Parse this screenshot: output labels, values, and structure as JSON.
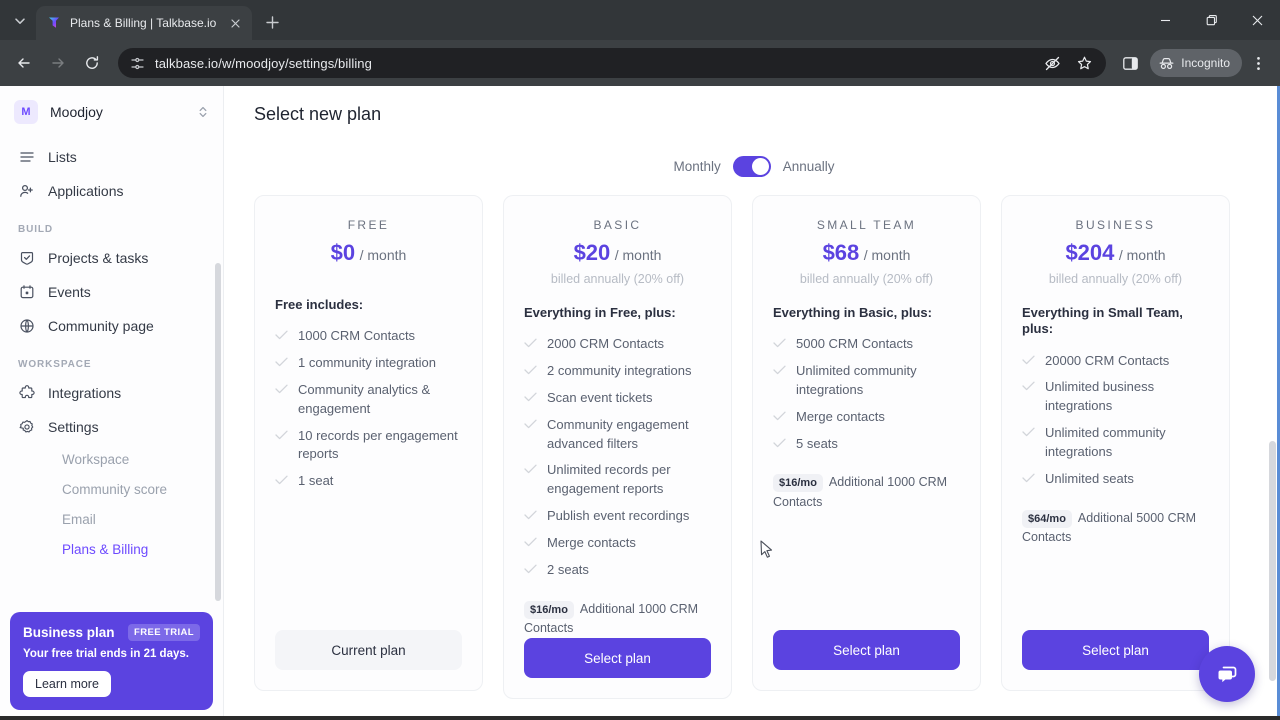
{
  "browser": {
    "tab": {
      "title": "Plans & Billing | Talkbase.io",
      "favicon_icon": "talkbase-logo-icon",
      "close_icon": "close-icon"
    },
    "tab_list_icon": "chevron-down-icon",
    "new_tab_label": "+",
    "window": {
      "minimize_icon": "minimize-icon",
      "maximize_icon": "maximize-icon",
      "close_icon": "close-icon"
    },
    "nav": {
      "back_icon": "back-arrow-icon",
      "forward_icon": "forward-arrow-icon",
      "reload_icon": "reload-icon"
    },
    "omnibox": {
      "url": "talkbase.io/w/moodjoy/settings/billing",
      "site_settings_icon": "tune-icon",
      "tracking_icon": "eye-slash-icon",
      "bookmark_icon": "star-icon"
    },
    "side_panel_icon": "side-panel-icon",
    "incognito": {
      "label": "Incognito",
      "icon": "incognito-hat-icon"
    },
    "menu_icon": "three-dot-menu-icon"
  },
  "sidebar": {
    "workspace": {
      "initial": "M",
      "name": "Moodjoy",
      "switcher_icon": "chevron-updown-icon"
    },
    "items": [
      {
        "label": "Lists",
        "icon": "list-icon"
      },
      {
        "label": "Applications",
        "icon": "user-plus-icon"
      }
    ],
    "sections": [
      {
        "label": "BUILD",
        "items": [
          {
            "label": "Projects & tasks",
            "icon": "checkbox-shield-icon"
          },
          {
            "label": "Events",
            "icon": "calendar-icon"
          },
          {
            "label": "Community page",
            "icon": "globe-icon"
          }
        ]
      },
      {
        "label": "WORKSPACE",
        "items": [
          {
            "label": "Integrations",
            "icon": "puzzle-icon"
          },
          {
            "label": "Settings",
            "icon": "gear-icon"
          }
        ]
      }
    ],
    "settings_subitems": [
      {
        "label": "Workspace",
        "active": false
      },
      {
        "label": "Community score",
        "active": false
      },
      {
        "label": "Email",
        "active": false
      },
      {
        "label": "Plans & Billing",
        "active": true
      }
    ],
    "trial_card": {
      "title": "Business plan",
      "badge": "FREE TRIAL",
      "subtitle": "Your free trial ends in 21 days.",
      "button": "Learn more"
    }
  },
  "main": {
    "title": "Select new plan",
    "billing_toggle": {
      "left_label": "Monthly",
      "right_label": "Annually",
      "selected": "Annually"
    },
    "plans": [
      {
        "name": "FREE",
        "price": "$0",
        "period": "/ month",
        "billed_note": "",
        "includes_heading": "Free includes:",
        "features": [
          "1000 CRM Contacts",
          "1 community integration",
          "Community analytics & engagement",
          "10 records per engagement reports",
          "1 seat"
        ],
        "addon_price": "",
        "addon_text": "",
        "cta": "Current plan",
        "cta_style": "ghost"
      },
      {
        "name": "BASIC",
        "price": "$20",
        "period": "/ month",
        "billed_note": "billed annually (20% off)",
        "includes_heading": "Everything in Free, plus:",
        "features": [
          "2000 CRM Contacts",
          "2 community integrations",
          "Scan event tickets",
          "Community engagement advanced filters",
          "Unlimited records per engagement reports",
          "Publish event recordings",
          "Merge contacts",
          "2 seats"
        ],
        "addon_price": "$16/mo",
        "addon_text": "Additional 1000 CRM Contacts",
        "cta": "Select plan",
        "cta_style": "primary"
      },
      {
        "name": "SMALL TEAM",
        "price": "$68",
        "period": "/ month",
        "billed_note": "billed annually (20% off)",
        "includes_heading": "Everything in Basic, plus:",
        "features": [
          "5000 CRM Contacts",
          "Unlimited community integrations",
          "Merge contacts",
          "5 seats"
        ],
        "addon_price": "$16/mo",
        "addon_text": "Additional 1000 CRM Contacts",
        "cta": "Select plan",
        "cta_style": "primary"
      },
      {
        "name": "BUSINESS",
        "price": "$204",
        "period": "/ month",
        "billed_note": "billed annually (20% off)",
        "includes_heading": "Everything in Small Team, plus:",
        "features": [
          "20000 CRM Contacts",
          "Unlimited business integrations",
          "Unlimited community integrations",
          "Unlimited seats"
        ],
        "addon_price": "$64/mo",
        "addon_text": "Additional 5000 CRM Contacts",
        "cta": "Select plan",
        "cta_style": "primary"
      }
    ],
    "chat_widget_icon": "chat-bubble-icon"
  },
  "colors": {
    "accent": "#5b43e0",
    "accent_light": "#ede9fe",
    "text": "#2b3040",
    "muted": "#6b7280"
  }
}
